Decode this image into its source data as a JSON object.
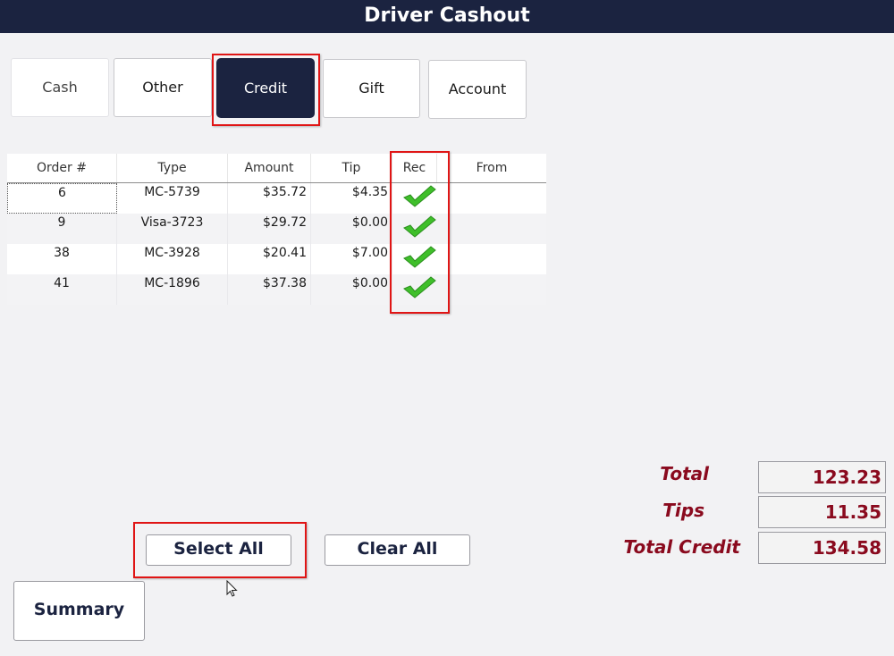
{
  "window": {
    "title": "Driver Cashout"
  },
  "tabs": [
    {
      "label": "Cash"
    },
    {
      "label": "Other"
    },
    {
      "label": "Credit"
    },
    {
      "label": "Gift"
    },
    {
      "label": "Account"
    }
  ],
  "active_tab": "Credit",
  "grid": {
    "columns": [
      "Order #",
      "Type",
      "Amount",
      "Tip",
      "Rec",
      "From"
    ],
    "rows": [
      {
        "order": "6",
        "type": "MC-5739",
        "amount": "$35.72",
        "tip": "$4.35",
        "rec": true,
        "from": ""
      },
      {
        "order": "9",
        "type": "Visa-3723",
        "amount": "$29.72",
        "tip": "$0.00",
        "rec": true,
        "from": ""
      },
      {
        "order": "38",
        "type": "MC-3928",
        "amount": "$20.41",
        "tip": "$7.00",
        "rec": true,
        "from": ""
      },
      {
        "order": "41",
        "type": "MC-1896",
        "amount": "$37.38",
        "tip": "$0.00",
        "rec": true,
        "from": ""
      }
    ]
  },
  "buttons": {
    "select_all": "Select All",
    "clear_all": "Clear All",
    "summary": "Summary"
  },
  "totals": {
    "total_label": "Total",
    "total_value": "123.23",
    "tips_label": "Tips",
    "tips_value": "11.35",
    "total_credit_label": "Total Credit",
    "total_credit_value": "134.58"
  },
  "colors": {
    "titlebar": "#1b2340",
    "highlight": "#e01515",
    "totals_text": "#8a0a1e",
    "check": "#3fbf2a"
  }
}
